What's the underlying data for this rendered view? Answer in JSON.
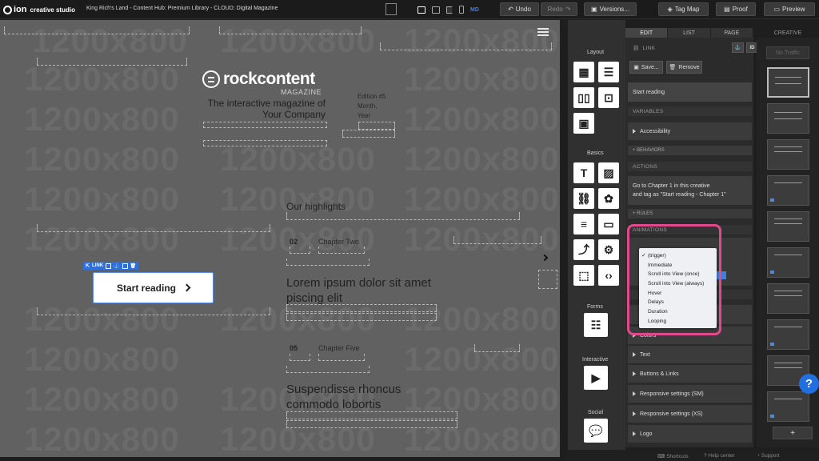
{
  "app": {
    "logo_ion": "ion",
    "logo_suffix": "creative studio"
  },
  "breadcrumb": "King Rich's Land  -  Content Hub: Premium Library  -  CLOUD: Digital Magazine",
  "toolbar": {
    "device_label": "MD",
    "undo_label": "Undo",
    "redo_label": "Redo",
    "versions_label": "Versions...",
    "tagmap_label": "Tag Map",
    "proof_label": "Proof",
    "preview_label": "Preview"
  },
  "canvas": {
    "watermark": "1200x800",
    "brand_name": "rockcontent",
    "brand_sub": "MAGAZINE",
    "tagline": "The interactive magazine of Your Company",
    "edition": "Edition #5\nMonth,\nYear",
    "highlights_title": "Our highlights",
    "items": [
      {
        "num": "02",
        "chapter": "Chapter Two",
        "headline": "Lorem ipsum dolor sit amet piscing elit"
      },
      {
        "num": "05",
        "chapter": "Chapter Five",
        "headline": "Suspendisse rhoncus commodo lobortis"
      }
    ],
    "cta_label": "Start reading",
    "link_toolbar_label": "LINK"
  },
  "components": {
    "layout_heading": "Layout",
    "basics_heading": "Basics",
    "forms_heading": "Forms",
    "interactive_heading": "Interactive",
    "social_heading": "Social"
  },
  "properties": {
    "tabs": [
      "EDIT",
      "LIST",
      "PAGE"
    ],
    "creative_tab": "CREATIVE",
    "element_type": "LINK",
    "id_label": "ID",
    "save_label": "Save...",
    "remove_label": "Remove",
    "link_text": "Start reading",
    "variables_heading": "VARIABLES",
    "accessibility_label": "Accessibility",
    "behaviors_heading": "+ BEHAVIORS",
    "actions_heading": "ACTIONS",
    "action_line1": "Go to Chapter 1 in this creative",
    "action_line2": "and tag as \"Start reading - Chapter 1\"",
    "rules_heading": "+ RULES",
    "animations_heading": "ANIMATIONS",
    "animation_options": [
      "(trigger)",
      "Immediate",
      "Scroll into View (once)",
      "Scroll into View (always)",
      "Hover",
      "Delays",
      "Duration",
      "Looping"
    ],
    "style_sections": [
      "Colors",
      "Text",
      "Buttons & Links",
      "Responsive settings (SM)",
      "Responsive settings (XS)",
      "Logo"
    ]
  },
  "thumbnails": {
    "no_traffic_label": "No Traffic",
    "add_label": "+"
  },
  "footer": {
    "shortcuts_label": "Shortcuts",
    "help_label": "Help center",
    "support_label": "Support"
  },
  "help_button_label": "?"
}
